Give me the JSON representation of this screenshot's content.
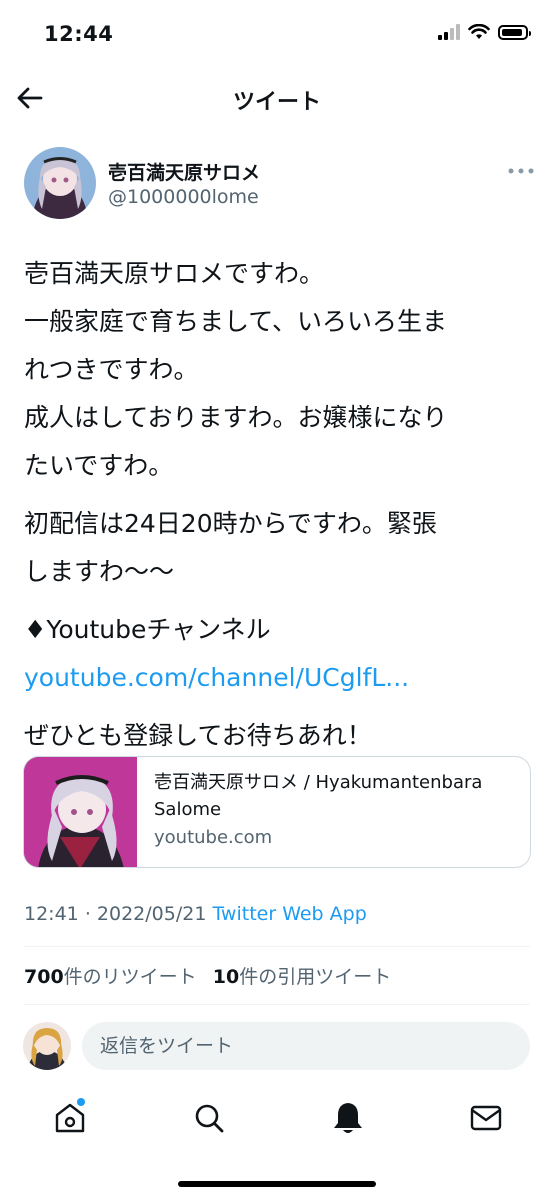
{
  "status_bar": {
    "time": "12:44"
  },
  "header": {
    "title": "ツイート"
  },
  "author": {
    "display_name": "壱百満天原サロメ",
    "handle": "@1000000lome"
  },
  "tweet": {
    "lines": [
      "壱百満天原サロメですわ。",
      "一般家庭で育ちまして、いろいろ生ま",
      "れつきですわ。",
      "成人はしておりますわ。お嬢様になり",
      "たいですわ。"
    ],
    "lines2": [
      "初配信は24日20時からですわ。緊張",
      "しますわ〜〜"
    ],
    "channel_label": "♦Youtubeチャンネル",
    "channel_link": "youtube.com/channel/UCglfL...",
    "closing": "ぜひとも登録してお待ちあれ！"
  },
  "card": {
    "title": "壱百満天原サロメ / Hyakumantenbara Salome",
    "domain": "youtube.com"
  },
  "meta": {
    "time": "12:41",
    "separator": "·",
    "date": "2022/05/21",
    "source": "Twitter Web App"
  },
  "stats": {
    "retweets_count": "700",
    "retweets_label": "件のリツイート",
    "quotes_count": "10",
    "quotes_label": "件の引用ツイート"
  },
  "reply": {
    "placeholder": "返信をツイート"
  },
  "colors": {
    "link": "#1d9bf0",
    "secondary_text": "#536471",
    "card_bg": "#c0379a",
    "notification_dot": "#1d9bf0"
  },
  "icons": [
    "back-arrow-icon",
    "more-icon",
    "home-icon",
    "search-icon",
    "notifications-bell-icon",
    "messages-envelope-icon"
  ]
}
